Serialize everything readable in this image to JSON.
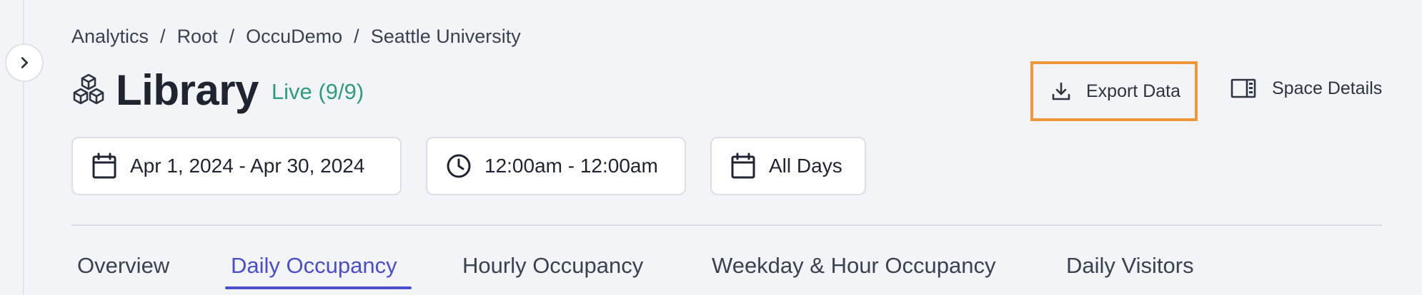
{
  "breadcrumb": [
    "Analytics",
    "Root",
    "OccuDemo",
    "Seattle University"
  ],
  "breadcrumb_separator": "/",
  "space": {
    "title": "Library",
    "status": "Live (9/9)",
    "icon": "cubes-icon"
  },
  "actions": {
    "export_label": "Export Data",
    "details_label": "Space Details"
  },
  "filters": {
    "date_range": "Apr 1, 2024 - Apr 30, 2024",
    "time_range": "12:00am - 12:00am",
    "days": "All Days"
  },
  "tabs": [
    {
      "label": "Overview"
    },
    {
      "label": "Daily Occupancy",
      "active": true
    },
    {
      "label": "Hourly Occupancy"
    },
    {
      "label": "Weekday & Hour Occupancy"
    },
    {
      "label": "Daily Visitors"
    }
  ],
  "colors": {
    "accent": "#4a4ec9",
    "live": "#2e9b82",
    "highlight": "#f0983a"
  }
}
